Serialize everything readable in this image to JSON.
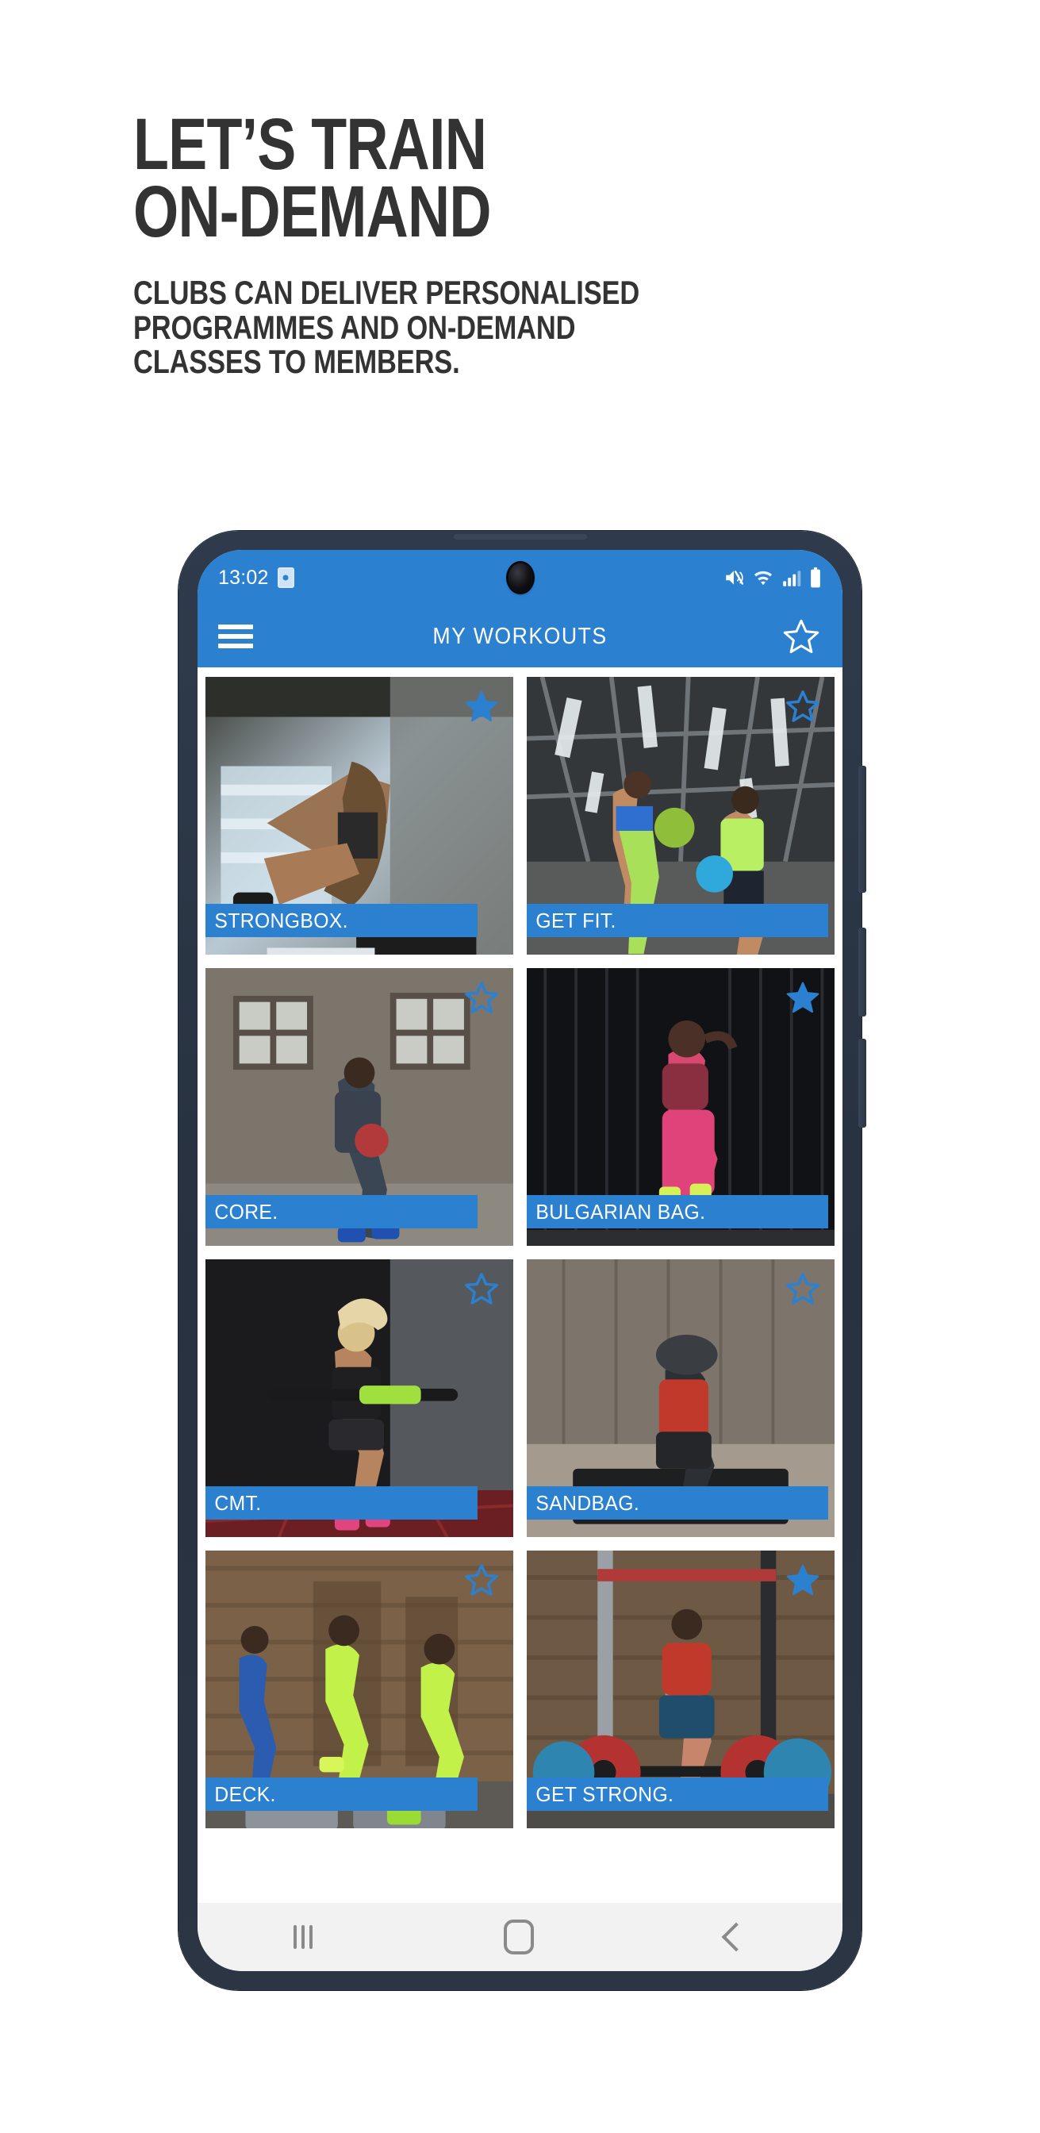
{
  "promo": {
    "headline": "LET’S TRAIN\nON-DEMAND",
    "subhead": "CLUBS CAN DELIVER PERSONALISED\nPROGRAMMES AND ON-DEMAND\nCLASSES TO MEMBERS."
  },
  "colors": {
    "brand_blue": "#2b80cf",
    "heading_gray": "#333333",
    "phone_bezel": "#2f3b4c",
    "navbar_gray": "#f2f2f2"
  },
  "statusbar": {
    "time": "13:02",
    "alarm_icon": "alarm-icon",
    "mute_icon": "volume-mute-icon",
    "wifi_icon": "wifi-icon",
    "signal_icon": "cellular-signal-icon",
    "battery_icon": "battery-full-icon"
  },
  "appbar": {
    "menu_icon": "hamburger-menu-icon",
    "title": "MY WORKOUTS",
    "favourite_icon": "star-outline-icon"
  },
  "workouts": [
    {
      "label": "STRONGBOX.",
      "starred": true,
      "star_icon": "star-filled-icon",
      "label_width": "w-90",
      "theme": "strongbox"
    },
    {
      "label": "GET FIT.",
      "starred": false,
      "star_icon": "star-outline-icon",
      "label_width": "w-100",
      "theme": "getfit"
    },
    {
      "label": "CORE.",
      "starred": false,
      "star_icon": "star-outline-icon",
      "label_width": "w-90",
      "theme": "core"
    },
    {
      "label": "BULGARIAN BAG.",
      "starred": true,
      "star_icon": "star-filled-icon",
      "label_width": "w-100",
      "theme": "bulgarian"
    },
    {
      "label": "CMT.",
      "starred": false,
      "star_icon": "star-outline-icon",
      "label_width": "w-90",
      "theme": "cmt"
    },
    {
      "label": "SANDBAG.",
      "starred": false,
      "star_icon": "star-outline-icon",
      "label_width": "w-100",
      "theme": "sandbag"
    },
    {
      "label": "DECK.",
      "starred": false,
      "star_icon": "star-outline-icon",
      "label_width": "w-90",
      "theme": "deck"
    },
    {
      "label": "GET STRONG.",
      "starred": true,
      "star_icon": "star-filled-icon",
      "label_width": "w-100",
      "theme": "getstrong"
    }
  ],
  "navbar": {
    "recents_icon": "recents-icon",
    "home_icon": "home-icon",
    "back_icon": "back-icon"
  }
}
